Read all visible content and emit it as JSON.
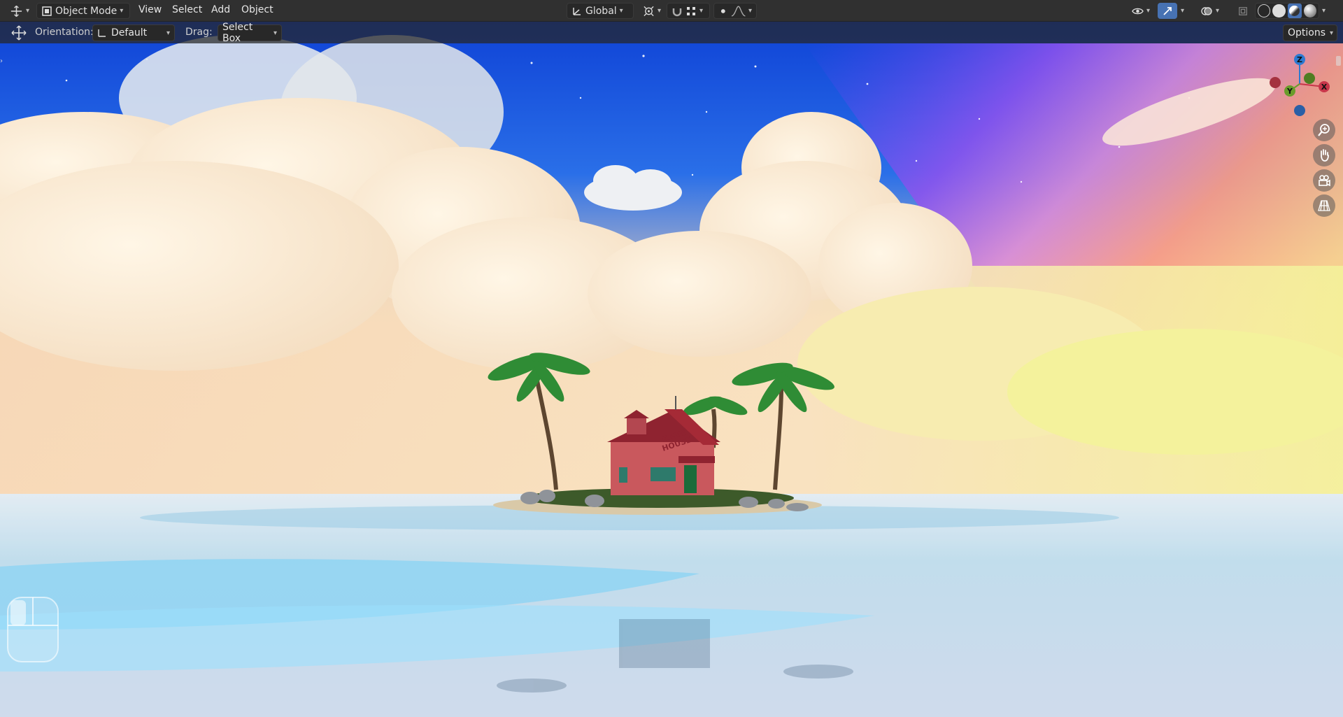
{
  "header": {
    "editor_type_icon": "move-gizmo-icon",
    "mode": "Object Mode",
    "menus": [
      "View",
      "Select",
      "Add",
      "Object"
    ],
    "transform_orientation": "Global",
    "options_label": "Options"
  },
  "toolbar": {
    "orientation_label": "Orientation:",
    "orientation_value": "Default",
    "drag_label": "Drag:",
    "drag_value": "Select Box"
  },
  "gizmo": {
    "axes": [
      "X",
      "Y",
      "Z"
    ],
    "colors": {
      "x": "#c8364a",
      "y": "#6a9c2b",
      "z": "#2c7ad1"
    }
  },
  "nav_buttons": [
    "zoom-icon",
    "hand-pan-icon",
    "camera-icon",
    "grid-perspective-icon"
  ],
  "scene": {
    "house_sign": "KAME HOUSE",
    "colors": {
      "sky_top": "#0a3fd8",
      "cloud": "#fbeed8",
      "sea": "#8fd6f6",
      "roof": "#9b2430",
      "walls": "#c9585d"
    }
  }
}
